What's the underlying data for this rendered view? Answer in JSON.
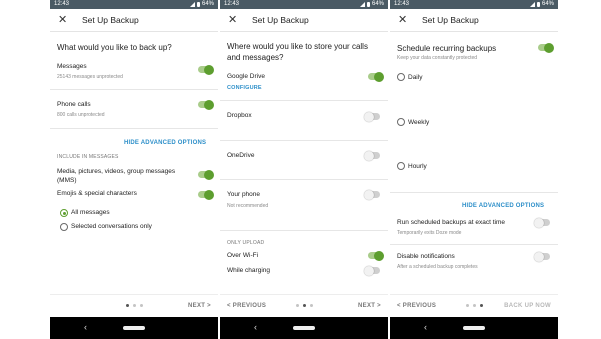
{
  "status": {
    "time": "12:43",
    "battery": "64%"
  },
  "screen1": {
    "title": "Set Up Backup",
    "question": "What would you like to back up?",
    "messages": {
      "label": "Messages",
      "sub": "25143 messages unprotected",
      "on": true
    },
    "phone_calls": {
      "label": "Phone calls",
      "sub": "800 calls unprotected",
      "on": true
    },
    "hide_advanced": "HIDE ADVANCED OPTIONS",
    "include_header": "INCLUDE IN MESSAGES",
    "mms": {
      "label_line1": "Media, pictures, videos, group messages",
      "label_line2": "(MMS)",
      "on": true
    },
    "emojis": {
      "label": "Emojis & special characters",
      "on": true
    },
    "radio_all": "All messages",
    "radio_selected": "Selected conversations only",
    "next": "NEXT >"
  },
  "screen2": {
    "title": "Set Up Backup",
    "question_line1": "Where would you like to store your calls",
    "question_line2": "and messages?",
    "google_drive": {
      "label": "Google Drive",
      "configure": "CONFIGURE",
      "on": true
    },
    "dropbox": {
      "label": "Dropbox",
      "on": false
    },
    "onedrive": {
      "label": "OneDrive",
      "on": false
    },
    "your_phone": {
      "label": "Your phone",
      "sub": "Not recommended",
      "on": false
    },
    "only_upload": "ONLY UPLOAD",
    "wifi": {
      "label": "Over Wi-Fi",
      "on": true
    },
    "charging": {
      "label": "While charging",
      "on": false
    },
    "previous": "< PREVIOUS",
    "next": "NEXT >"
  },
  "screen3": {
    "title": "Set Up Backup",
    "schedule": {
      "label": "Schedule recurring backups",
      "sub": "Keep your data constantly protected",
      "on": true
    },
    "daily": "Daily",
    "weekly": "Weekly",
    "hourly": "Hourly",
    "hide_advanced": "HIDE ADVANCED OPTIONS",
    "exact_time": {
      "label": "Run scheduled backups at exact time",
      "sub": "Temporarily exits Doze mode",
      "on": false
    },
    "disable_notif": {
      "label": "Disable notifications",
      "sub": "After a scheduled backup completes",
      "on": false
    },
    "previous": "< PREVIOUS",
    "back_up_now": "BACK UP NOW"
  },
  "icons": {
    "close": "close-icon",
    "back": "nav-back-icon",
    "home": "nav-home-pill"
  },
  "colors": {
    "accent_green": "#5d9e2f",
    "link_blue": "#2d8fc9",
    "status_bar": "#4a5a64"
  }
}
